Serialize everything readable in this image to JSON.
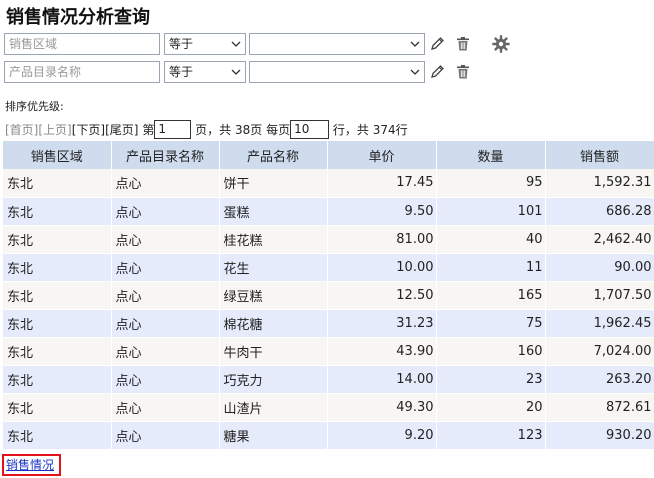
{
  "title": "销售情况分析查询",
  "filters": [
    {
      "field_placeholder": "销售区域",
      "operator": "等于",
      "value": ""
    },
    {
      "field_placeholder": "产品目录名称",
      "operator": "等于",
      "value": ""
    }
  ],
  "sort_label": "排序优先级:",
  "pager": {
    "first": "[首页]",
    "prev": "[上页]",
    "next": "[下页]",
    "last": "[尾页]",
    "page_prefix": "第",
    "page_value": "1",
    "page_suffix": "页，共 38页 每页",
    "rows_value": "10",
    "rows_suffix": "行，共 374行"
  },
  "table": {
    "headers": [
      "销售区域",
      "产品目录名称",
      "产品名称",
      "单价",
      "数量",
      "销售额"
    ],
    "rows": [
      [
        "东北",
        "点心",
        "饼干",
        "17.45",
        "95",
        "1,592.31"
      ],
      [
        "东北",
        "点心",
        "蛋糕",
        "9.50",
        "101",
        "686.28"
      ],
      [
        "东北",
        "点心",
        "桂花糕",
        "81.00",
        "40",
        "2,462.40"
      ],
      [
        "东北",
        "点心",
        "花生",
        "10.00",
        "11",
        "90.00"
      ],
      [
        "东北",
        "点心",
        "绿豆糕",
        "12.50",
        "165",
        "1,707.50"
      ],
      [
        "东北",
        "点心",
        "棉花糖",
        "31.23",
        "75",
        "1,962.45"
      ],
      [
        "东北",
        "点心",
        "牛肉干",
        "43.90",
        "160",
        "7,024.00"
      ],
      [
        "东北",
        "点心",
        "巧克力",
        "14.00",
        "23",
        "263.20"
      ],
      [
        "东北",
        "点心",
        "山渣片",
        "49.30",
        "20",
        "872.61"
      ],
      [
        "东北",
        "点心",
        "糖果",
        "9.20",
        "123",
        "930.20"
      ]
    ]
  },
  "bottom_link": "销售情况",
  "icons": {
    "edit": "pencil-icon",
    "delete": "trash-icon",
    "settings": "gear-icon",
    "dropdown": "chevron-down-icon"
  },
  "colors": {
    "header_bg": "#cfdcee",
    "row_odd": "#f8f6f2",
    "row_even": "#e6ebfb",
    "link": "#1a34c8",
    "highlight_border": "#e1121a"
  }
}
